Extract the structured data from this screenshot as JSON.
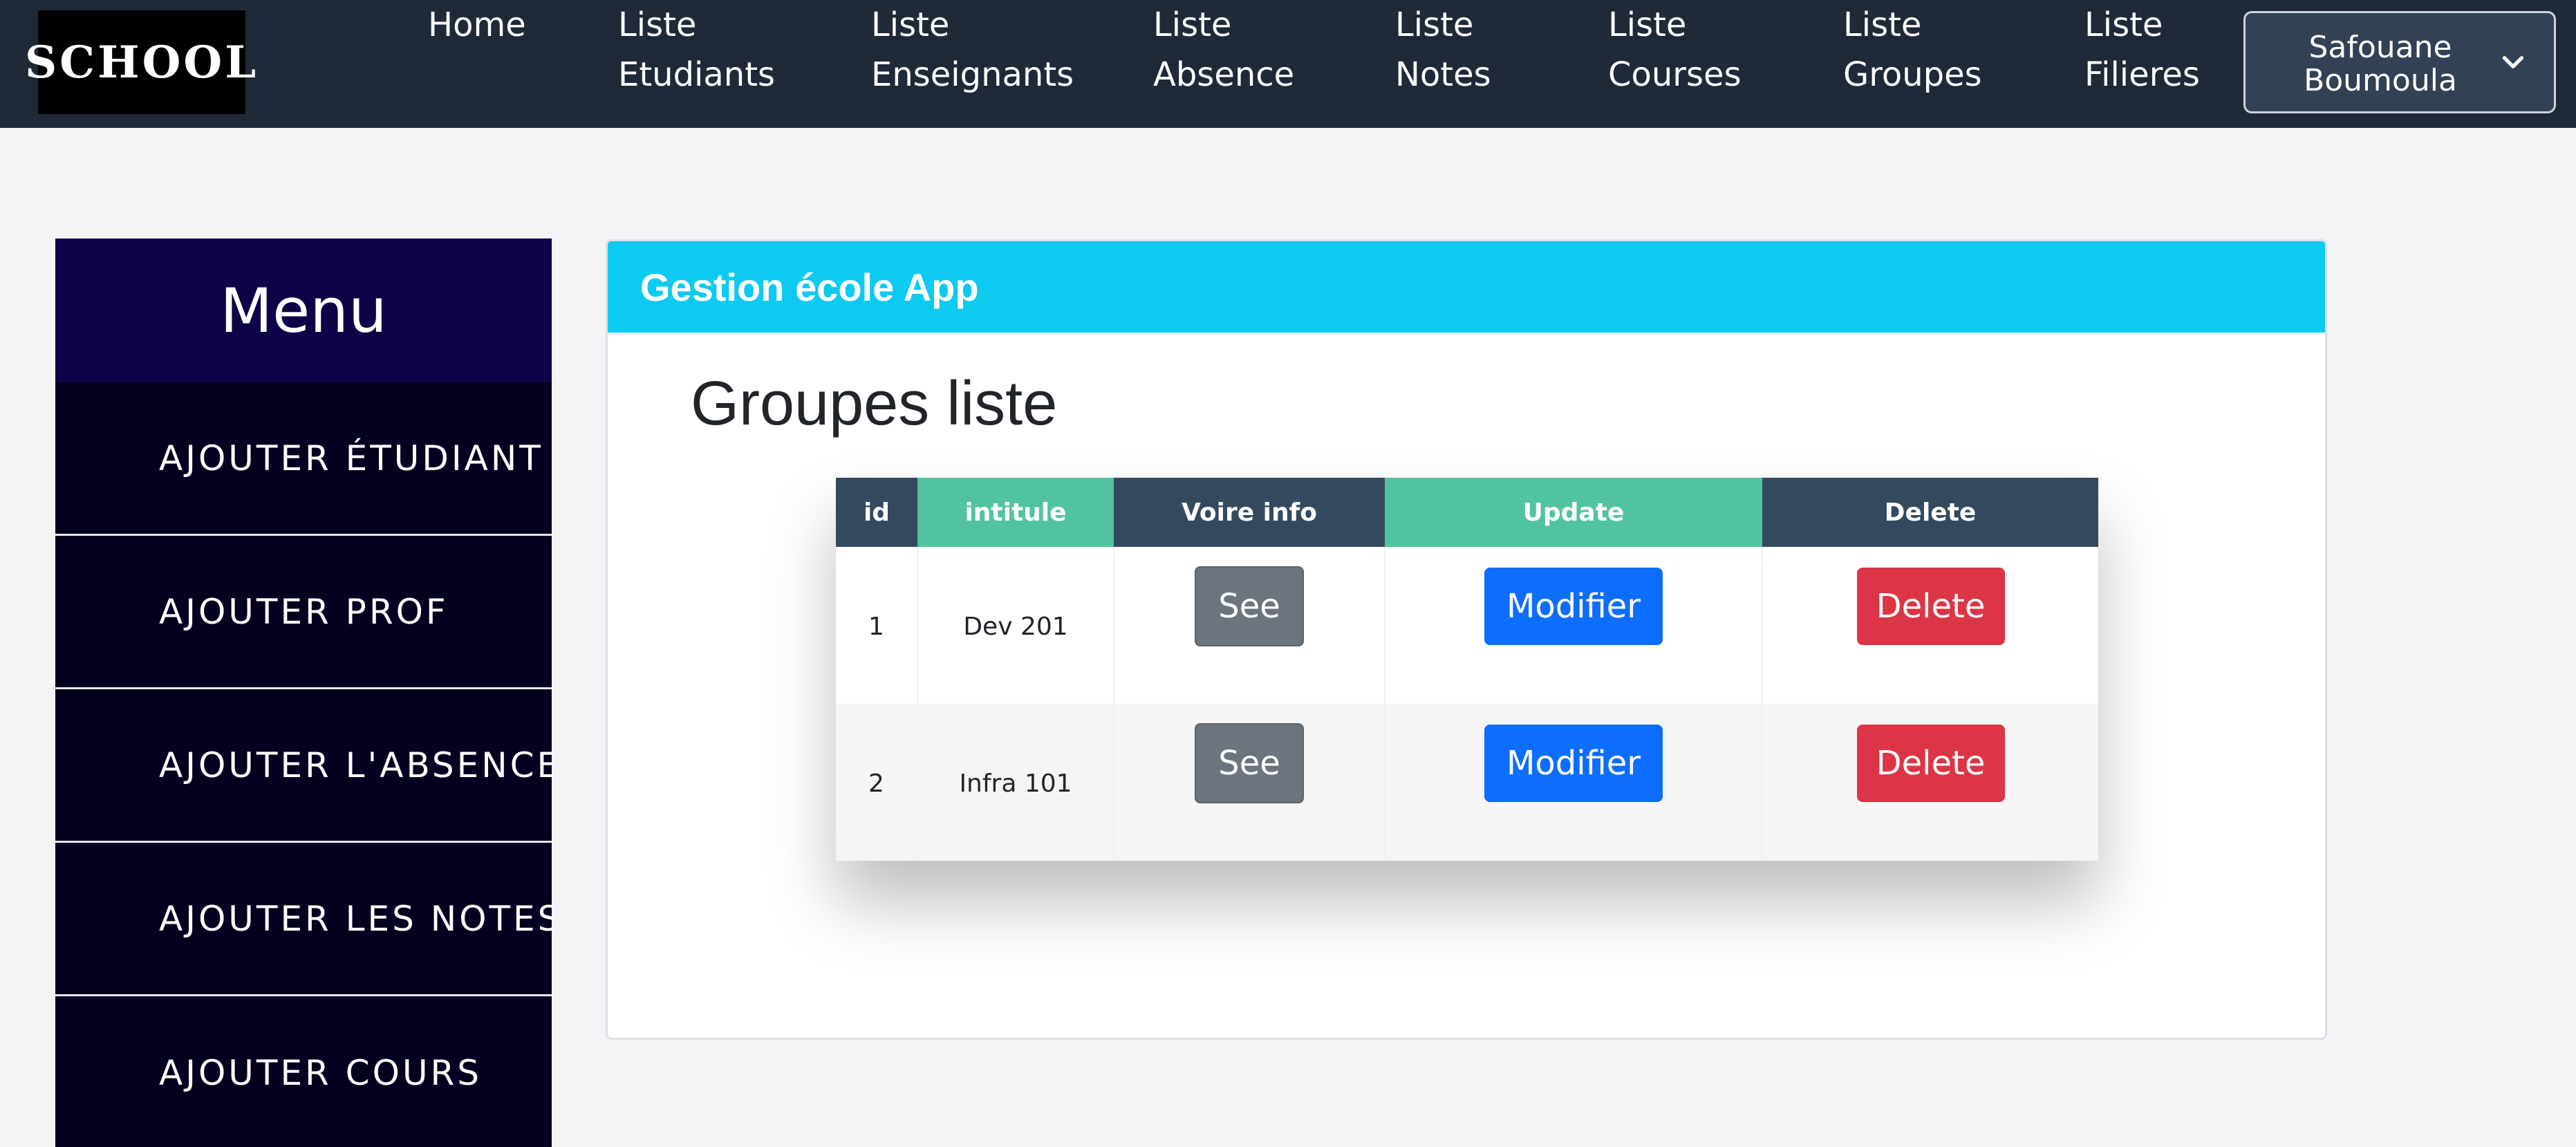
{
  "navbar": {
    "logo_text": "SCHOOL",
    "links": [
      {
        "line1": "Home",
        "line2": ""
      },
      {
        "line1": "Liste",
        "line2": "Etudiants"
      },
      {
        "line1": "Liste",
        "line2": "Enseignants"
      },
      {
        "line1": "Liste",
        "line2": "Absence"
      },
      {
        "line1": "Liste",
        "line2": "Notes"
      },
      {
        "line1": "Liste",
        "line2": "Courses"
      },
      {
        "line1": "Liste",
        "line2": "Groupes"
      },
      {
        "line1": "Liste",
        "line2": "Filieres"
      }
    ],
    "user": {
      "first_name": "Safouane",
      "last_name": "Boumoula",
      "icon": "chevron-down-icon"
    }
  },
  "sidebar": {
    "title": "Menu",
    "items": [
      {
        "label": "AJOUTER ÉTUDIANT"
      },
      {
        "label": "AJOUTER PROF"
      },
      {
        "label": "AJOUTER L'ABSENCE"
      },
      {
        "label": "AJOUTER LES NOTES"
      },
      {
        "label": "AJOUTER COURS"
      }
    ]
  },
  "card": {
    "header": "Gestion école App",
    "title": "Groupes liste"
  },
  "table": {
    "columns": [
      "id",
      "intitule",
      "Voire info",
      "Update",
      "Delete"
    ],
    "rows": [
      {
        "id": "1",
        "intitule": "Dev 201",
        "see": "See",
        "modify": "Modifier",
        "delete": "Delete"
      },
      {
        "id": "2",
        "intitule": "Infra 101",
        "see": "See",
        "modify": "Modifier",
        "delete": "Delete"
      }
    ]
  },
  "colors": {
    "navbar": "#1f2937",
    "sidebar": "#05001f",
    "card_header": "#0dcaf0",
    "th_dark": "#34495e",
    "th_green": "#52c3a0",
    "btn_see": "#6c757d",
    "btn_modify": "#0d6efd",
    "btn_delete": "#dc3545"
  }
}
